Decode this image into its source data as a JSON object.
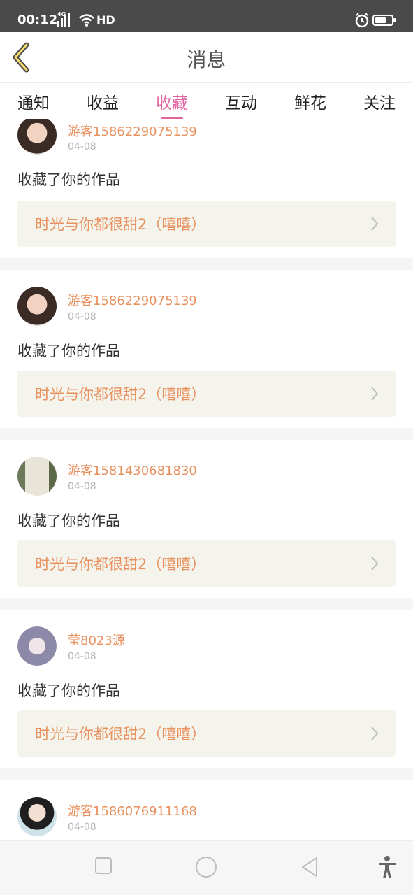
{
  "status": {
    "time": "00:12",
    "network": "4G",
    "hd": "HD"
  },
  "header": {
    "title": "消息"
  },
  "tabs": [
    {
      "label": "通知"
    },
    {
      "label": "收益"
    },
    {
      "label": "收藏",
      "active": true
    },
    {
      "label": "互动"
    },
    {
      "label": "鲜花"
    },
    {
      "label": "关注"
    }
  ],
  "items": [
    {
      "user": "游客1586229075139",
      "date": "04-08",
      "action": "收藏了你的作品",
      "work": "时光与你都很甜2（嘻嘻）"
    },
    {
      "user": "游客1586229075139",
      "date": "04-08",
      "action": "收藏了你的作品",
      "work": "时光与你都很甜2（嘻嘻）"
    },
    {
      "user": "游客1581430681830",
      "date": "04-08",
      "action": "收藏了你的作品",
      "work": "时光与你都很甜2（嘻嘻）"
    },
    {
      "user": "莹8023源",
      "date": "04-08",
      "action": "收藏了你的作品",
      "work": "时光与你都很甜2（嘻嘻）"
    },
    {
      "user": "游客1586076911168",
      "date": "04-08"
    }
  ],
  "colors": {
    "accent": "#e0649f",
    "username": "#e8915e",
    "card_bg": "#f4f4ec"
  },
  "icons": [
    "back-arrow-icon",
    "chevron-right-icon",
    "square-nav-icon",
    "circle-nav-icon",
    "triangle-back-nav-icon",
    "accessibility-icon",
    "wifi-icon",
    "alarm-icon",
    "battery-icon",
    "signal-icon"
  ]
}
